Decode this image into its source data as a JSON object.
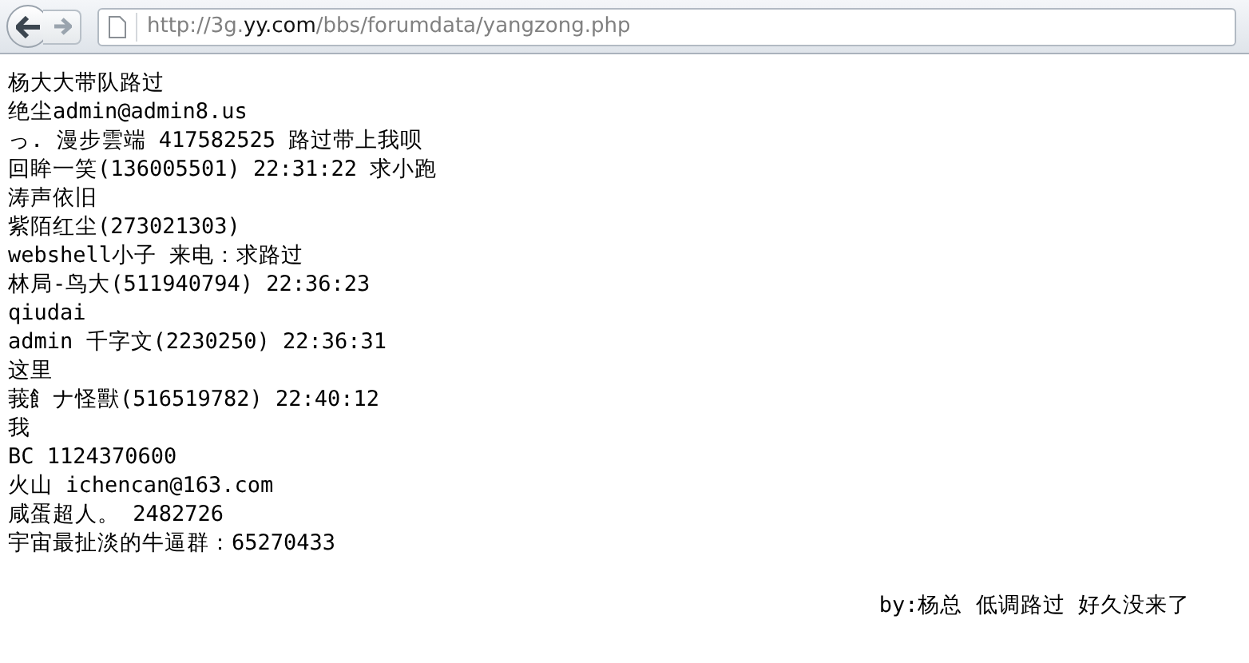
{
  "toolbar": {
    "url": {
      "scheme": "http://3g.",
      "domain": "yy.com",
      "path": "/bbs/forumdata/yangzong.php"
    }
  },
  "lines": [
    "杨大大带队路过",
    "绝尘admin@admin8.us",
    "っ. 漫步雲端 417582525 路过带上我呗",
    "回眸一笑(136005501) 22:31:22 求小跑",
    "涛声依旧",
    "紫陌红尘(273021303)",
    "webshell小子 来电：求路过",
    "林局-鸟大(511940794) 22:36:23",
    "qiudai",
    "admin 千字文(2230250) 22:36:31",
    "这里",
    "莪飠ナ怪獸(516519782) 22:40:12",
    "我",
    "BC 1124370600",
    "火山 ichencan@163.com",
    "咸蛋超人。 2482726",
    "宇宙最扯淡的牛逼群：65270433"
  ],
  "footer": "by:杨总 低调路过 好久没来了"
}
